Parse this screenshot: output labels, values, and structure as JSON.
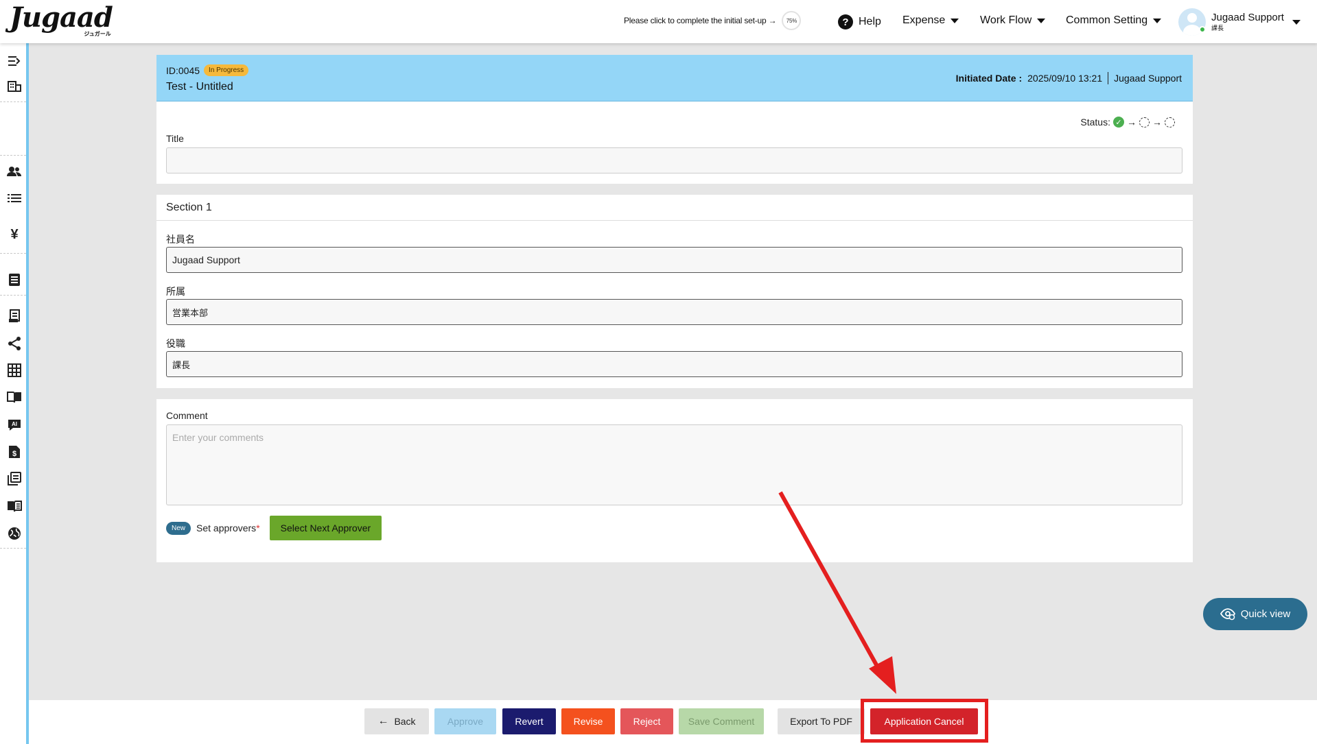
{
  "header": {
    "logo_text": "Jugaad",
    "logo_subtext": "ジュガール",
    "setup_text": "Please click to complete the initial set-up →",
    "setup_progress": "75%",
    "help_label": "Help",
    "menus": [
      "Expense",
      "Work Flow",
      "Common Setting"
    ],
    "user_name": "Jugaad Support",
    "user_role": "課長"
  },
  "sidebar": {
    "icons": [
      "collapse-menu-icon",
      "building-icon",
      "users-icon",
      "list-icon",
      "yen-icon",
      "document-icon",
      "receipt-icon",
      "share-icon",
      "grid-icon",
      "book-icon",
      "ai-chat-icon",
      "invoice-icon",
      "library-icon",
      "manual-icon",
      "globe-icon"
    ]
  },
  "record": {
    "id": "ID:0045",
    "status_badge": "In Progress",
    "title": "Test - Untitled",
    "initiated_label": "Initiated Date :",
    "initiated_value": "2025/09/10 13:21",
    "initiator": "Jugaad Support",
    "status_label": "Status:",
    "title_field_label": "Title",
    "title_field_value": ""
  },
  "section": {
    "title": "Section 1",
    "fields": [
      {
        "label": "社員名",
        "value": "Jugaad Support"
      },
      {
        "label": "所属",
        "value": "営業本部"
      },
      {
        "label": "役職",
        "value": "課長"
      }
    ]
  },
  "comment": {
    "label": "Comment",
    "placeholder": "Enter your comments",
    "new_badge": "New",
    "set_approvers_label": "Set approvers",
    "required_mark": "*",
    "select_next_label": "Select Next Approver"
  },
  "quick_view_label": "Quick view",
  "actions": {
    "back": "Back",
    "approve": "Approve",
    "revert": "Revert",
    "revise": "Revise",
    "reject": "Reject",
    "save_comment": "Save Comment",
    "export_pdf": "Export To PDF",
    "application_cancel": "Application Cancel"
  },
  "colors": {
    "header_bar": "#94d6f7",
    "badge_progress": "#f6b93b",
    "revert": "#1b1b6e",
    "revise": "#f4511e",
    "reject": "#e4565a",
    "cancel": "#d3232a",
    "select_next": "#6aa72a",
    "annotation": "#e41f1f"
  }
}
